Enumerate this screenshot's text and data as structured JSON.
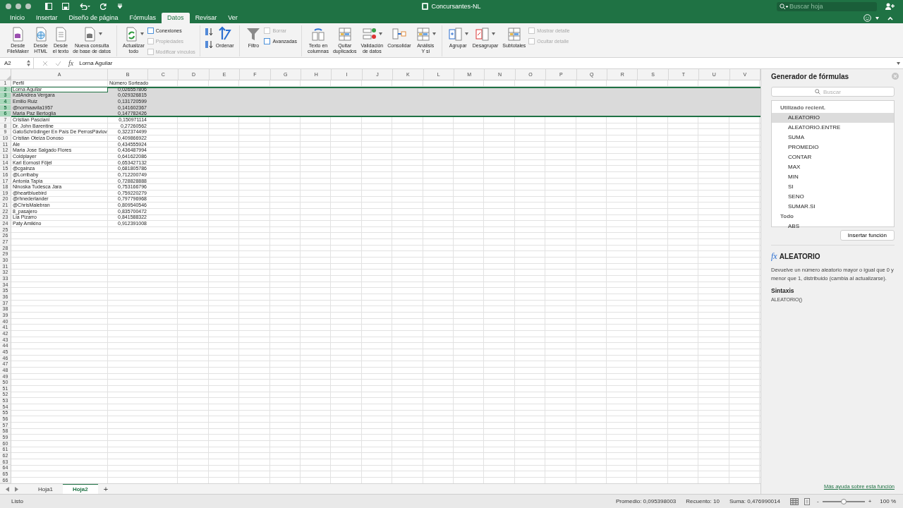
{
  "window": {
    "title": "Concursantes-NL",
    "search_placeholder": "Buscar hoja"
  },
  "tabs": [
    {
      "label": "Inicio",
      "selected": false
    },
    {
      "label": "Insertar",
      "selected": false
    },
    {
      "label": "Diseño de página",
      "selected": false
    },
    {
      "label": "Fórmulas",
      "selected": false
    },
    {
      "label": "Datos",
      "selected": true
    },
    {
      "label": "Revisar",
      "selected": false
    },
    {
      "label": "Ver",
      "selected": false
    }
  ],
  "ribbon": {
    "groups": [
      {
        "items": [
          {
            "kind": "large",
            "label": "Desde\nFileMaker",
            "disabled": false,
            "dropdown": false
          },
          {
            "kind": "large",
            "label": "Desde\nHTML",
            "disabled": false,
            "dropdown": false
          },
          {
            "kind": "large",
            "label": "Desde\nel texto",
            "disabled": false,
            "dropdown": false
          },
          {
            "kind": "large",
            "label": "Nueva consulta\nde base de datos",
            "disabled": false,
            "dropdown": true
          }
        ]
      },
      {
        "items": [
          {
            "kind": "large",
            "label": "Actualizar\ntodo",
            "disabled": false,
            "dropdown": true
          },
          {
            "kind": "small",
            "label": "Conexiones",
            "disabled": false
          },
          {
            "kind": "small",
            "label": "Propiedades",
            "disabled": true
          },
          {
            "kind": "small",
            "label": "Modificar vínculos",
            "disabled": true
          }
        ]
      },
      {
        "items": [
          {
            "kind": "icon",
            "disabled": false
          },
          {
            "kind": "icon",
            "disabled": false
          },
          {
            "kind": "large",
            "label": "Ordenar",
            "disabled": false,
            "dropdown": false
          }
        ]
      },
      {
        "items": [
          {
            "kind": "large",
            "label": "Filtro",
            "disabled": false,
            "dropdown": false
          },
          {
            "kind": "small",
            "label": "Borrar",
            "disabled": true
          },
          {
            "kind": "small",
            "label": "Avanzadas",
            "disabled": false
          }
        ]
      },
      {
        "items": [
          {
            "kind": "large",
            "label": "Texto en\ncolumnas",
            "disabled": false,
            "dropdown": false
          },
          {
            "kind": "large",
            "label": "Quitar\nduplicados",
            "disabled": false,
            "dropdown": false
          },
          {
            "kind": "large",
            "label": "Validación\nde datos",
            "disabled": false,
            "dropdown": true
          },
          {
            "kind": "large",
            "label": "Consolidar",
            "disabled": false,
            "dropdown": false
          },
          {
            "kind": "large",
            "label": "Análisis\nY si",
            "disabled": false,
            "dropdown": true
          }
        ]
      },
      {
        "items": [
          {
            "kind": "large",
            "label": "Agrupar",
            "disabled": false,
            "dropdown": true
          },
          {
            "kind": "large",
            "label": "Desagrupar",
            "disabled": false,
            "dropdown": true
          },
          {
            "kind": "large",
            "label": "Subtotales",
            "disabled": false,
            "dropdown": false
          },
          {
            "kind": "small",
            "label": "Mostrar detalle",
            "disabled": true
          },
          {
            "kind": "small",
            "label": "Ocultar detalle",
            "disabled": true
          }
        ]
      }
    ]
  },
  "formula_bar": {
    "name_box": "A2",
    "fx_label": "fx",
    "value": "Lorna Aguilar"
  },
  "grid": {
    "columns": [
      "A",
      "B",
      "C",
      "D",
      "E",
      "F",
      "G",
      "H",
      "I",
      "J",
      "K",
      "L",
      "M",
      "N",
      "O",
      "P",
      "Q",
      "R",
      "S",
      "T",
      "U",
      "V"
    ],
    "row_numbers": [
      "1",
      "2",
      "3",
      "4",
      "5",
      "6",
      "7",
      "8",
      "9",
      "10",
      "11",
      "12",
      "13",
      "14",
      "15",
      "16",
      "17",
      "18",
      "19",
      "20",
      "21",
      "22",
      "23",
      "24",
      "25",
      "26",
      "27",
      "28",
      "29",
      "30",
      "31",
      "32",
      "33",
      "34",
      "35",
      "36",
      "37",
      "38",
      "39",
      "40",
      "41",
      "42",
      "43",
      "44",
      "45",
      "46",
      "47",
      "48",
      "49",
      "50",
      "51",
      "52",
      "53",
      "54",
      "55",
      "56",
      "57",
      "58",
      "59",
      "60",
      "61",
      "62",
      "63",
      "64",
      "65",
      "66"
    ],
    "rows": [
      {
        "cells": [
          "Perfil",
          "Número Sorteado"
        ],
        "selected": false,
        "active": false
      },
      {
        "cells": [
          "Lorna Aguilar",
          "0,026557806"
        ],
        "selected": true,
        "active": true
      },
      {
        "cells": [
          "KatAndrea Vergara",
          "0,029326815"
        ],
        "selected": true,
        "active": false
      },
      {
        "cells": [
          "Emilio Ruiz",
          "0,131720599"
        ],
        "selected": true,
        "active": false
      },
      {
        "cells": [
          "@normaavila1957",
          "0,141602367"
        ],
        "selected": true,
        "active": false
      },
      {
        "cells": [
          "Maria Paz Bertoglia",
          "0,147782426"
        ],
        "selected": true,
        "active": false
      },
      {
        "cells": [
          "Cristian Pasciani",
          "0,150971114"
        ],
        "selected": false,
        "active": false
      },
      {
        "cells": [
          "Dr. John Barentine",
          "0,27260562"
        ],
        "selected": false,
        "active": false
      },
      {
        "cells": [
          "GatoSchrödinger En País De PerrosPávlov",
          "0,322374499"
        ],
        "selected": false,
        "active": false
      },
      {
        "cells": [
          "Cristian Oteiza Donoso",
          "0,409866922"
        ],
        "selected": false,
        "active": false
      },
      {
        "cells": [
          "Ale",
          "0,434555924"
        ],
        "selected": false,
        "active": false
      },
      {
        "cells": [
          "Maria Jose Salgado Flores",
          "0,436487994"
        ],
        "selected": false,
        "active": false
      },
      {
        "cells": [
          "Coldplayer",
          "0,641622086"
        ],
        "selected": false,
        "active": false
      },
      {
        "cells": [
          "Karl Eornost Föjel",
          "0,653427132"
        ],
        "selected": false,
        "active": false
      },
      {
        "cells": [
          "@cgainza",
          "0,681805786"
        ],
        "selected": false,
        "active": false
      },
      {
        "cells": [
          "@Lorribaby",
          "0,712200749"
        ],
        "selected": false,
        "active": false
      },
      {
        "cells": [
          "Antonia Tapia",
          "0,728828888"
        ],
        "selected": false,
        "active": false
      },
      {
        "cells": [
          "Ninoska Tudesca Jara",
          "0,753166796"
        ],
        "selected": false,
        "active": false
      },
      {
        "cells": [
          "@heartbluebird",
          "0,759220279"
        ],
        "selected": false,
        "active": false
      },
      {
        "cells": [
          "@rhnederlander",
          "0,797796968"
        ],
        "selected": false,
        "active": false
      },
      {
        "cells": [
          "@ChrisMalebran",
          "0,809540546"
        ],
        "selected": false,
        "active": false
      },
      {
        "cells": [
          "8_pasajero",
          "0,835700472"
        ],
        "selected": false,
        "active": false
      },
      {
        "cells": [
          "Lía Pizarro",
          "0,841588322"
        ],
        "selected": false,
        "active": false
      },
      {
        "cells": [
          "Paty Amikino",
          "0,912391008"
        ],
        "selected": false,
        "active": false
      }
    ]
  },
  "sheet_tabs": [
    {
      "label": "Hoja1",
      "selected": false
    },
    {
      "label": "Hoja2",
      "selected": true
    }
  ],
  "add_sheet": "+",
  "formula_builder": {
    "title": "Generador de fórmulas",
    "search_placeholder": "Buscar",
    "list": [
      {
        "kind": "header",
        "label": "Utilizado recient."
      },
      {
        "kind": "function",
        "label": "ALEATORIO",
        "selected": true
      },
      {
        "kind": "function",
        "label": "ALEATORIO.ENTRE",
        "selected": false
      },
      {
        "kind": "function",
        "label": "SUMA",
        "selected": false
      },
      {
        "kind": "function",
        "label": "PROMEDIO",
        "selected": false
      },
      {
        "kind": "function",
        "label": "CONTAR",
        "selected": false
      },
      {
        "kind": "function",
        "label": "MAX",
        "selected": false
      },
      {
        "kind": "function",
        "label": "MIN",
        "selected": false
      },
      {
        "kind": "function",
        "label": "SI",
        "selected": false
      },
      {
        "kind": "function",
        "label": "SENO",
        "selected": false
      },
      {
        "kind": "function",
        "label": "SUMAR.SI",
        "selected": false
      },
      {
        "kind": "header",
        "label": "Todo"
      },
      {
        "kind": "function",
        "label": "ABS",
        "selected": false
      }
    ],
    "insert_button": "Insertar función",
    "fx_label": "fx",
    "function_name": "ALEATORIO",
    "description": "Devuelve un número aleatorio mayor o igual que 0 y menor que 1, distribuido (cambia al actualizarse).",
    "syntax_heading": "Sintaxis",
    "syntax": "ALEATORIO()",
    "help_link": "Más ayuda sobre esta función"
  },
  "status_bar": {
    "status": "Listo",
    "stats": [
      "Promedio: 0,095398003",
      "Recuento: 10",
      "Suma: 0,476990014"
    ],
    "zoom_out": "-",
    "zoom_in": "+",
    "zoom": {
      "level": 0.5
    },
    "zoom_label": "100 %"
  }
}
